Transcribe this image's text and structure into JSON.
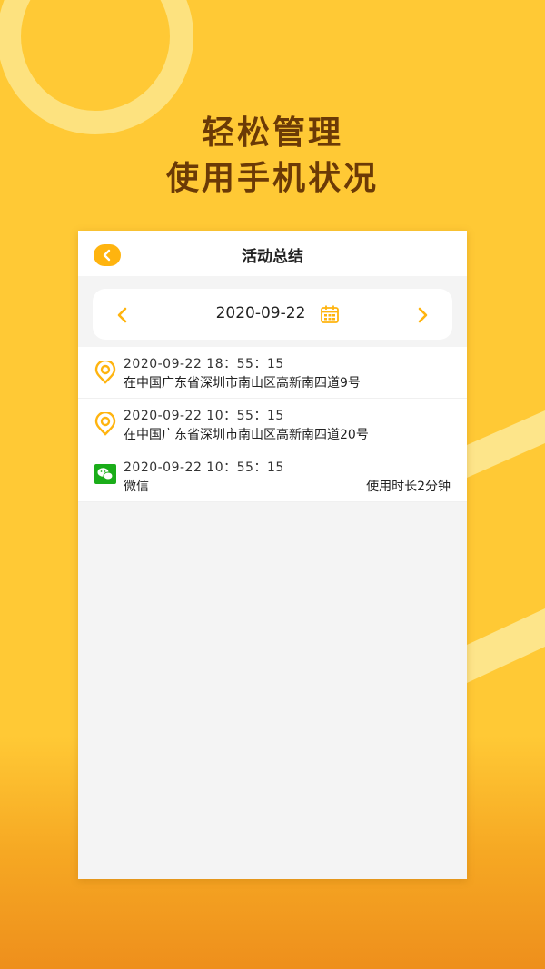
{
  "headline": {
    "line1": "轻松管理",
    "line2": "使用手机状况"
  },
  "app": {
    "title": "活动总结",
    "date": "2020-09-22",
    "records": [
      {
        "time": "2020-09-22  18：55：15",
        "desc": "在中国广东省深圳市南山区高新南四道9号",
        "extra": "",
        "icon": "location-icon"
      },
      {
        "time": "2020-09-22  10：55：15",
        "desc": "在中国广东省深圳市南山区高新南四道20号",
        "extra": "",
        "icon": "location-icon"
      },
      {
        "time": "2020-09-22  10：55：15",
        "desc": "微信",
        "extra": "使用时长2分钟",
        "icon": "wechat-icon"
      }
    ]
  },
  "colors": {
    "background": "#ffc935",
    "accent": "#ffb40f",
    "headline": "#6b3a06",
    "wechat": "#1aad19"
  }
}
